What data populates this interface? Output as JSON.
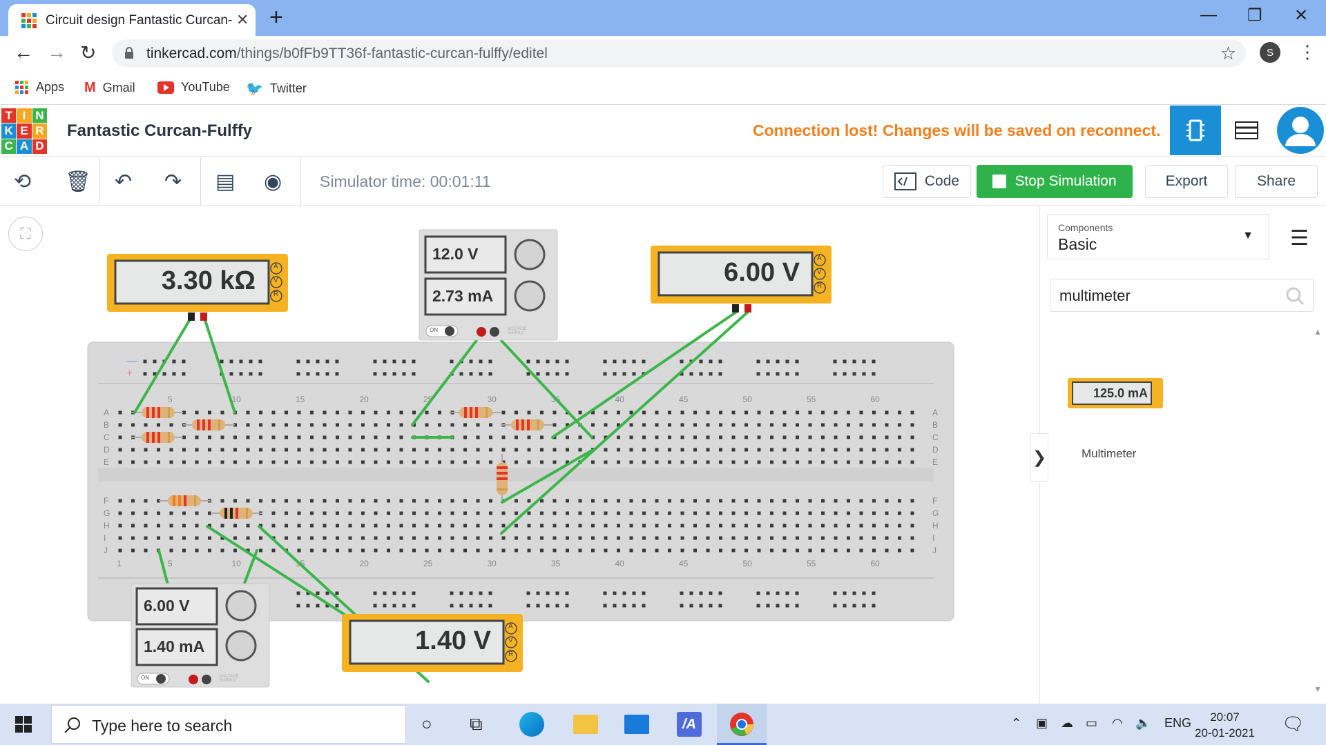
{
  "browser": {
    "tab_title": "Circuit design Fantastic Curcan-Fuffy",
    "url_domain": "tinkercad.com",
    "url_path": "/things/b0fFb9TT36f-fantastic-curcan-fulffy/editel",
    "profile_initial": "S",
    "bookmarks": [
      "Apps",
      "Gmail",
      "YouTube",
      "Twitter"
    ]
  },
  "app": {
    "logo_letters": [
      "T",
      "I",
      "N",
      "K",
      "E",
      "R",
      "C",
      "A",
      "D"
    ],
    "project_title": "Fantastic Curcan-Fulffy",
    "connection_status": "Connection lost! Changes will be saved on reconnect."
  },
  "toolbar": {
    "simulator_time": "Simulator time: 00:01:11",
    "code_label": "Code",
    "stop_label": "Stop Simulation",
    "export_label": "Export",
    "share_label": "Share"
  },
  "circuit": {
    "meter1_display": "3.30 kΩ",
    "meter2_display": "6.00 V",
    "meter3_display": "1.40 V",
    "supply1_voltage": "12.0 V",
    "supply1_current": "2.73 mA",
    "supply2_voltage": "6.00 V",
    "supply2_current": "1.40 mA",
    "meter_modes": [
      "A",
      "V",
      "R"
    ],
    "supply_switch": "ON",
    "supply_brand": "VOLTAGE SUPPLY",
    "column_numbers_top": [
      "5",
      "10",
      "15",
      "20",
      "25",
      "30",
      "35",
      "40",
      "45",
      "50",
      "55",
      "60"
    ],
    "column_numbers_bottom": [
      "1",
      "5",
      "10",
      "15",
      "20",
      "25",
      "30",
      "35",
      "40",
      "45",
      "50",
      "55",
      "60"
    ],
    "row_letters_top": [
      "A",
      "B",
      "C",
      "D",
      "E"
    ],
    "row_letters_bottom": [
      "F",
      "G",
      "H",
      "I",
      "J"
    ]
  },
  "sidepanel": {
    "components_label": "Components",
    "components_value": "Basic",
    "search_value": "multimeter",
    "result_display": "125.0 mA",
    "result_name": "Multimeter"
  },
  "taskbar": {
    "search_placeholder": "Type here to search",
    "language": "ENG",
    "time": "20:07",
    "date": "20-01-2021"
  },
  "colors": {
    "accent_blue": "#1a8fd6",
    "sim_green": "#2eb34b",
    "warning_orange": "#f07f1d",
    "meter_yellow": "#f5b324",
    "wire_green": "#3cb64b"
  }
}
